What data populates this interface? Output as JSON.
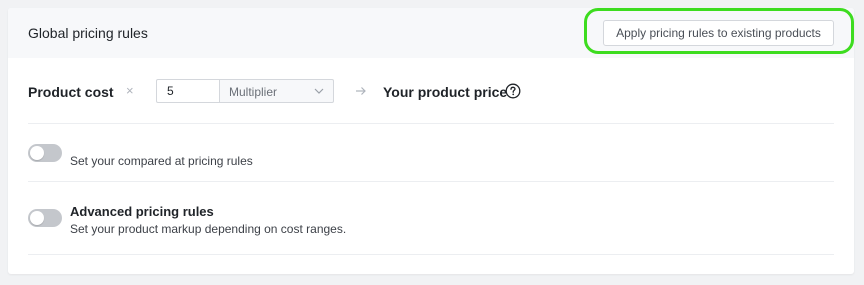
{
  "header": {
    "title": "Global pricing rules",
    "apply_button_label": "Apply pricing rules to existing products"
  },
  "formula": {
    "product_cost_label": "Product cost",
    "times_symbol": "×",
    "multiplier_value": "5",
    "multiplier_type": "Multiplier",
    "arrow_symbol": "→",
    "your_price_label": "Your product price"
  },
  "compare_at": {
    "label": "Set your compared at pricing rules",
    "enabled": false
  },
  "advanced": {
    "title": "Advanced pricing rules",
    "description": "Set your product markup depending on cost ranges.",
    "enabled": false
  },
  "colors": {
    "highlight": "#3ddc1f",
    "toggle_off": "#c4c7cc",
    "header_bg": "#f7f8fa"
  },
  "icons": {
    "help": "question-circle-icon",
    "select": "chevron-down-icon",
    "arrow": "arrow-right-icon"
  }
}
